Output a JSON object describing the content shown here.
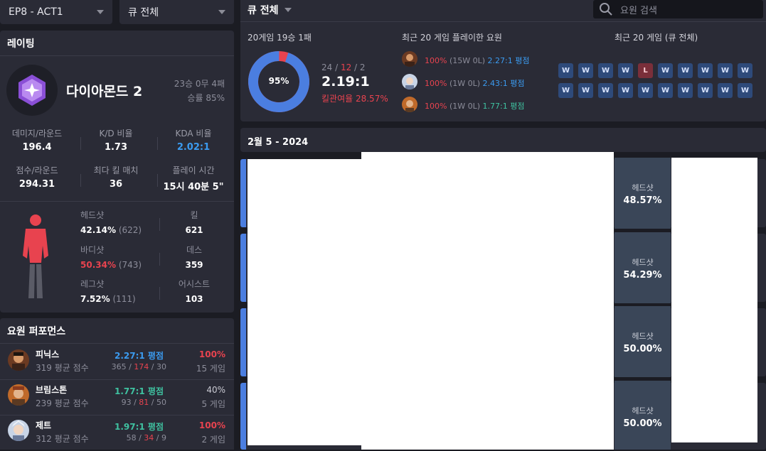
{
  "filters": {
    "season": "EP8 - ACT1",
    "queue_left": "큐 전체",
    "queue_main": "큐 전체",
    "search_placeholder": "요원 검색"
  },
  "rating": {
    "section_title": "레이팅",
    "rank_name": "다이아몬드 2",
    "record": "23승 0무 4패",
    "winrate": "승률 85%"
  },
  "stats": [
    {
      "label": "데미지/라운드",
      "value": "196.4"
    },
    {
      "label": "K/D 비율",
      "value": "1.73"
    },
    {
      "label": "KDA 비율",
      "value": "2.02:1"
    },
    {
      "label": "점수/라운드",
      "value": "294.31"
    },
    {
      "label": "최다 킬 매치",
      "value": "36"
    },
    {
      "label": "플레이 시간",
      "value": "15시 40분 5\""
    }
  ],
  "accuracy": {
    "head_label": "헤드샷",
    "head_pct": "42.14%",
    "head_count": "(622)",
    "body_label": "바디샷",
    "body_pct": "50.34%",
    "body_count": "(743)",
    "leg_label": "레그샷",
    "leg_pct": "7.52%",
    "leg_count": "(111)",
    "kill_label": "킬",
    "kill_val": "621",
    "death_label": "데스",
    "death_val": "359",
    "assist_label": "어시스트",
    "assist_val": "103"
  },
  "agent_perf": {
    "title": "요원 퍼포먼스",
    "rows": [
      {
        "name": "피닉스",
        "score": "319 평균 점수",
        "kda": "2.27:1 평점",
        "k": "365",
        "d": "174",
        "a": "30",
        "win": "100%",
        "games": "15 게임"
      },
      {
        "name": "브림스톤",
        "score": "239 평균 점수",
        "kda": "1.77:1 평점",
        "k": "93",
        "d": "81",
        "a": "50",
        "win": "40%",
        "games": "5 게임"
      },
      {
        "name": "제트",
        "score": "312 평균 점수",
        "kda": "1.97:1 평점",
        "k": "58",
        "d": "34",
        "a": "9",
        "win": "100%",
        "games": "2 게임"
      }
    ]
  },
  "summary": {
    "games_title": "20게임 19승 1패",
    "donut_pct": "95%",
    "donut_fraction": 0.95,
    "k": "24",
    "d": "12",
    "a": "2",
    "kda": "2.19:1",
    "kill_part": "킬관여율 28.57%",
    "recent_agents_title": "최근 20 게임 플레이한 요원",
    "recent_agents": [
      {
        "win": "100%",
        "rec": "(15W 0L)",
        "kda": "2.27:1 평점"
      },
      {
        "win": "100%",
        "rec": "(1W 0L)",
        "kda": "2.43:1 평점"
      },
      {
        "win": "100%",
        "rec": "(1W 0L)",
        "kda": "1.77:1 평점"
      }
    ],
    "recent_games_title": "최근 20 게임 (큐 전체)",
    "results": [
      "W",
      "W",
      "W",
      "W",
      "L",
      "W",
      "W",
      "W",
      "W",
      "W",
      "W",
      "W",
      "W",
      "W",
      "W",
      "W",
      "W",
      "W",
      "W",
      "W"
    ]
  },
  "matches": {
    "date": "2월 5 - 2024",
    "items": [
      {
        "hs_label": "헤드샷",
        "hs": "48.57%"
      },
      {
        "hs_label": "헤드샷",
        "hs": "54.29%"
      },
      {
        "hs_label": "헤드샷",
        "hs": "50.00%"
      },
      {
        "hs_label": "헤드샷",
        "hs": "50.00%"
      }
    ]
  },
  "colors": {
    "accent": "#4b7ee0",
    "loss": "#e8434f",
    "win_box": "#2e4a7a"
  }
}
